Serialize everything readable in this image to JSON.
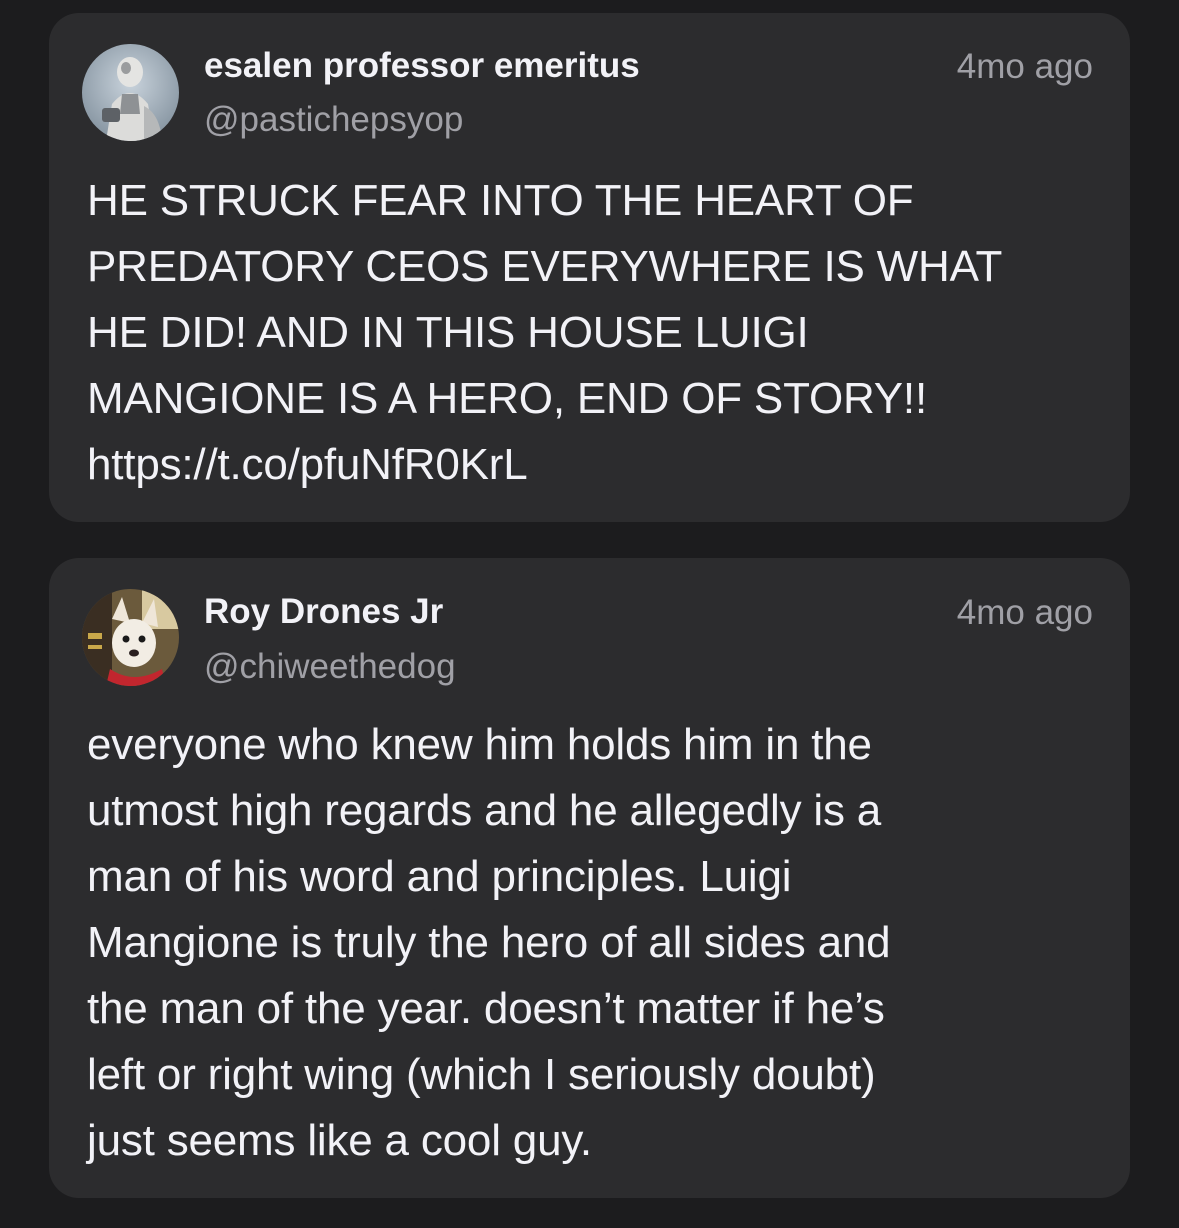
{
  "posts": [
    {
      "display_name": "esalen professor emeritus",
      "handle": "@pastichepsyop",
      "time": "4mo ago",
      "text": "HE STRUCK FEAR INTO THE HEART OF\nPREDATORY CEOS EVERYWHERE IS WHAT\nHE DID! AND IN THIS HOUSE LUIGI\nMANGIONE IS A HERO, END OF STORY!!\nhttps://t.co/pfuNfR0KrL",
      "avatar_icon": "statue-avatar-icon"
    },
    {
      "display_name": "Roy Drones Jr",
      "handle": "@chiweethedog",
      "time": "4mo ago",
      "text": "everyone who knew him holds him in the\nutmost high regards and he allegedly is a\nman of his word and principles. Luigi\nMangione is truly the hero of all sides and\nthe man of the year. doesn’t matter if he’s\nleft or right wing (which I seriously doubt)\njust seems like a cool guy.",
      "avatar_icon": "dog-avatar-icon"
    }
  ],
  "colors": {
    "background": "#1c1c1e",
    "card": "#2c2c2e",
    "text_primary": "#f2f2f7",
    "text_secondary": "#a0a0a6"
  }
}
